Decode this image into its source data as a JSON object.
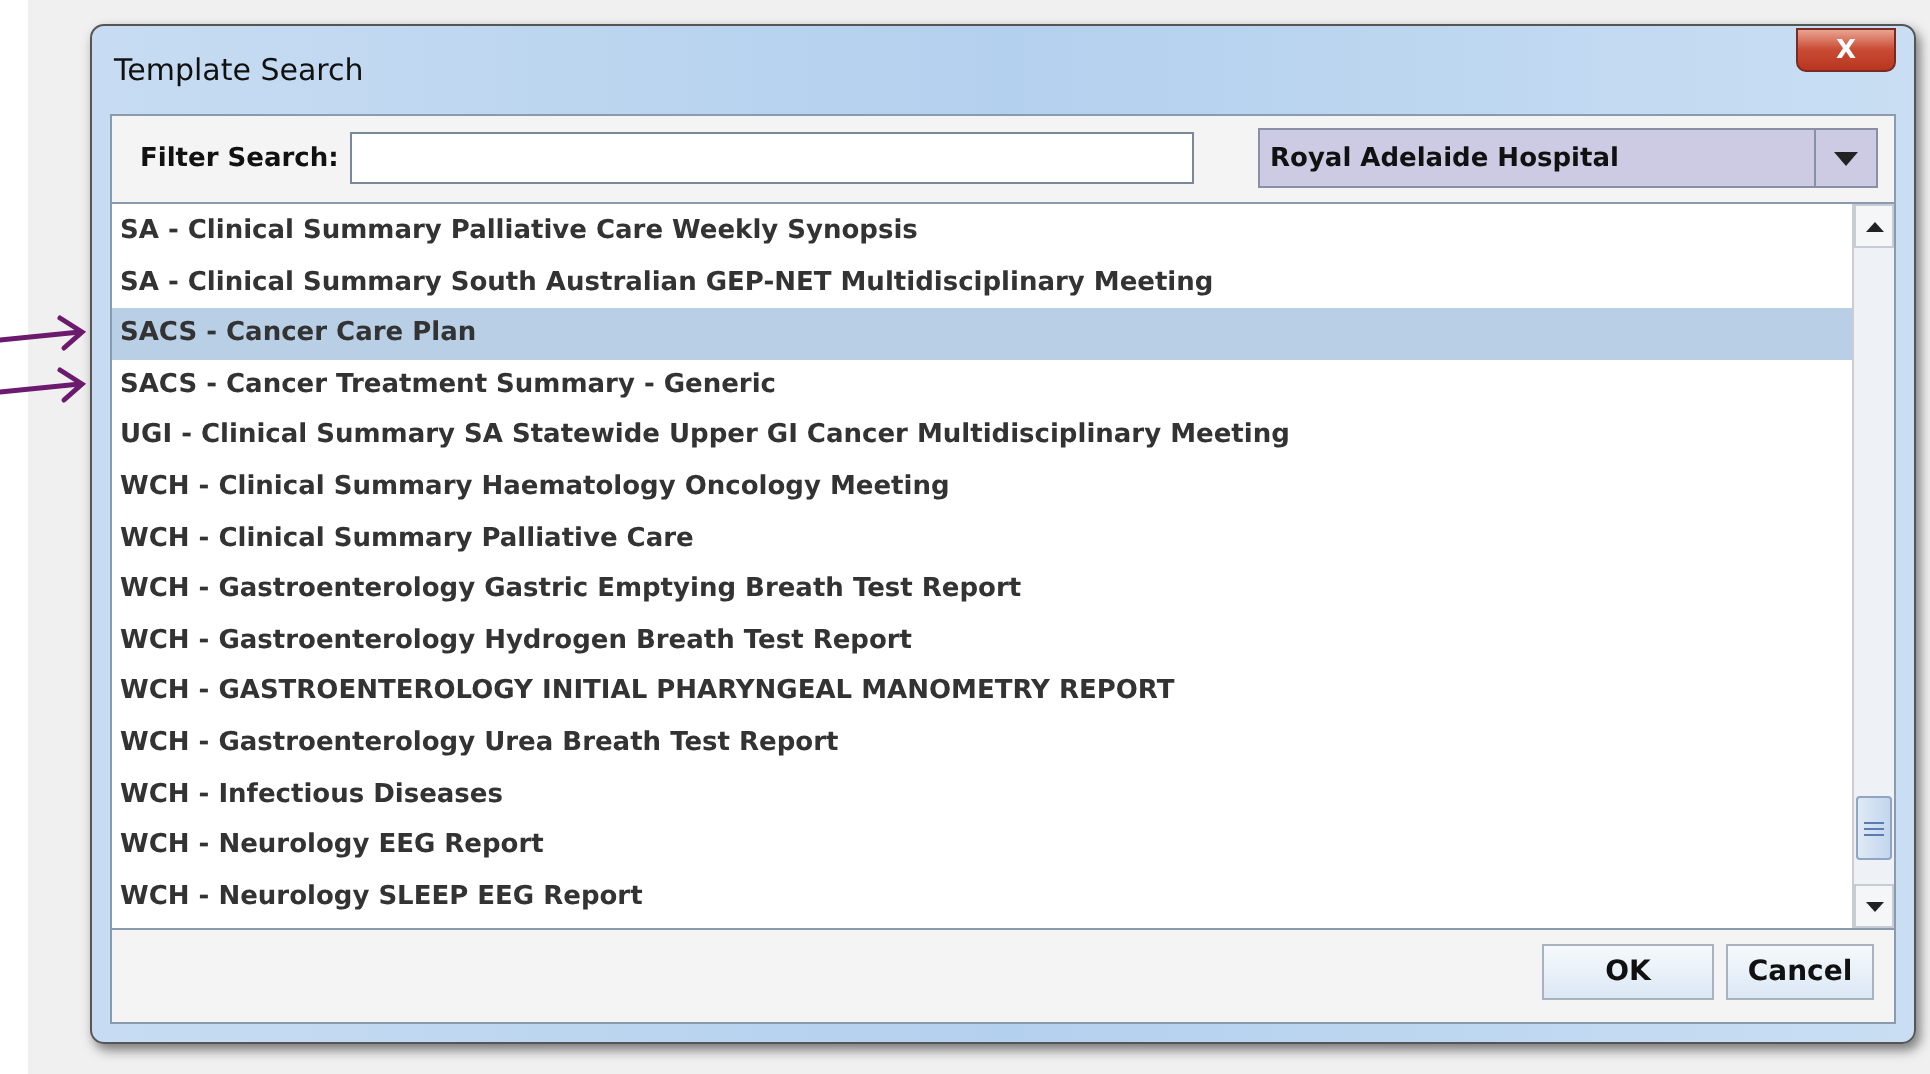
{
  "window": {
    "title": "Template Search",
    "close_label": "X"
  },
  "filter": {
    "label": "Filter Search:"
  },
  "hospital_select": {
    "value": "Royal Adelaide Hospital"
  },
  "templates": [
    {
      "label": "SA - Clinical Summary Palliative Care Weekly Synopsis",
      "selected": false,
      "pointed": false
    },
    {
      "label": "SA - Clinical Summary South Australian GEP-NET Multidisciplinary Meeting",
      "selected": false,
      "pointed": false
    },
    {
      "label": "SACS - Cancer Care Plan",
      "selected": true,
      "pointed": true
    },
    {
      "label": "SACS - Cancer Treatment Summary - Generic",
      "selected": false,
      "pointed": true
    },
    {
      "label": "UGI - Clinical Summary SA Statewide Upper GI Cancer Multidisciplinary Meeting",
      "selected": false,
      "pointed": false
    },
    {
      "label": "WCH - Clinical Summary Haematology Oncology Meeting",
      "selected": false,
      "pointed": false
    },
    {
      "label": "WCH - Clinical Summary Palliative Care",
      "selected": false,
      "pointed": false
    },
    {
      "label": "WCH - Gastroenterology Gastric Emptying Breath Test Report",
      "selected": false,
      "pointed": false
    },
    {
      "label": "WCH - Gastroenterology Hydrogen Breath Test Report",
      "selected": false,
      "pointed": false
    },
    {
      "label": "WCH - GASTROENTEROLOGY INITIAL PHARYNGEAL MANOMETRY REPORT",
      "selected": false,
      "pointed": false
    },
    {
      "label": "WCH - Gastroenterology Urea Breath Test Report",
      "selected": false,
      "pointed": false
    },
    {
      "label": "WCH - Infectious Diseases",
      "selected": false,
      "pointed": false
    },
    {
      "label": "WCH - Neurology EEG Report",
      "selected": false,
      "pointed": false
    },
    {
      "label": "WCH - Neurology SLEEP EEG Report",
      "selected": false,
      "pointed": false
    }
  ],
  "buttons": [
    {
      "label": "OK"
    },
    {
      "label": "Cancel"
    }
  ]
}
